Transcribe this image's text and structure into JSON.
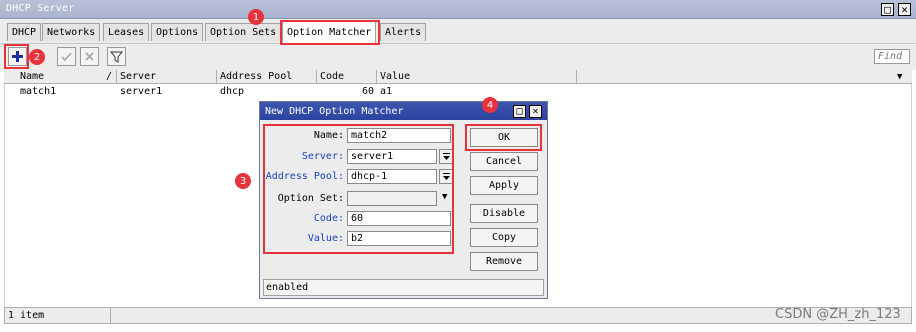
{
  "window": {
    "title": "DHCP Server",
    "restore_glyph": "□",
    "close_glyph": "✕"
  },
  "tabs": [
    {
      "label": "DHCP"
    },
    {
      "label": "Networks"
    },
    {
      "label": "Leases"
    },
    {
      "label": "Options"
    },
    {
      "label": "Option Sets"
    },
    {
      "label": "Option Matcher"
    },
    {
      "label": "Alerts"
    }
  ],
  "toolbar": {
    "find_placeholder": "Find",
    "icons": [
      "plus-icon",
      "check-icon",
      "cross-icon",
      "filter-icon"
    ]
  },
  "table": {
    "columns": [
      "Name",
      "Server",
      "Address Pool",
      "Code",
      "Value"
    ],
    "sort_glyph": "/",
    "rows": [
      {
        "name": "match1",
        "server": "server1",
        "address_pool": "dhcp",
        "code": "60",
        "value": "a1"
      }
    ],
    "status": "1 item"
  },
  "dialog": {
    "title": "New DHCP Option Matcher",
    "fields": {
      "name_label": "Name:",
      "name_value": "match2",
      "server_label": "Server:",
      "server_value": "server1",
      "pool_label": "Address Pool:",
      "pool_value": "dhcp-1",
      "optset_label": "Option Set:",
      "optset_value": "",
      "code_label": "Code:",
      "code_value": "60",
      "value_label": "Value:",
      "value_value": "b2"
    },
    "buttons": {
      "ok": "OK",
      "cancel": "Cancel",
      "apply": "Apply",
      "disable": "Disable",
      "copy": "Copy",
      "remove": "Remove"
    },
    "status": "enabled"
  },
  "annotations": {
    "badge1": "1",
    "badge2": "2",
    "badge3": "3",
    "badge4": "4"
  },
  "watermark": "CSDN @ZH_zh_123",
  "colors": {
    "annotation_red": "#e8323c",
    "dialog_title_blue": "#2d43a0",
    "label_blue": "#1c3fc8"
  }
}
